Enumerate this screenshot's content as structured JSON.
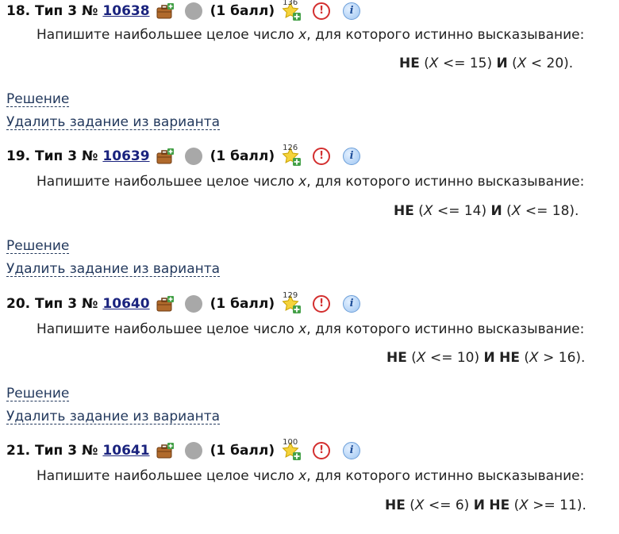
{
  "tasks": [
    {
      "number": "18. Тип 3 №",
      "id": "10638",
      "score": "(1 балл)",
      "star_count": "136",
      "question": "Напишите наибольшее целое число x, для которого истинно высказывание:",
      "expression": "НЕ (X <= 15) И (X < 20).",
      "solution_label": "Решение",
      "remove_label": "Удалить задание из варианта"
    },
    {
      "number": "19. Тип 3 №",
      "id": "10639",
      "score": "(1 балл)",
      "star_count": "126",
      "question": "Напишите наибольшее целое число x, для которого истинно высказывание:",
      "expression": "НЕ (X <= 14) И (X <= 18).",
      "solution_label": "Решение",
      "remove_label": "Удалить задание из варианта"
    },
    {
      "number": "20. Тип 3 №",
      "id": "10640",
      "score": "(1 балл)",
      "star_count": "129",
      "question": "Напишите наибольшее целое число x, для которого истинно высказывание:",
      "expression": "НЕ (X <= 10) И НЕ (X > 16).",
      "solution_label": "Решение",
      "remove_label": "Удалить задание из варианта"
    },
    {
      "number": "21. Тип 3 №",
      "id": "10641",
      "score": "(1 балл)",
      "star_count": "100",
      "question": "Напишите наибольшее целое число x, для которого истинно высказывание:",
      "expression": "НЕ (X <= 6) И НЕ (X >= 11)."
    }
  ],
  "icons": {
    "briefcase": "briefcase-add-icon",
    "status": "status-circle-icon",
    "star": "star-add-icon",
    "report": "report-error-icon",
    "info": "info-icon"
  },
  "colors": {
    "link": "#23395d",
    "task_id": "#1a237e",
    "status_circle": "#a8a8a8",
    "report": "#d32f2f",
    "info": "#9fc6f2"
  }
}
